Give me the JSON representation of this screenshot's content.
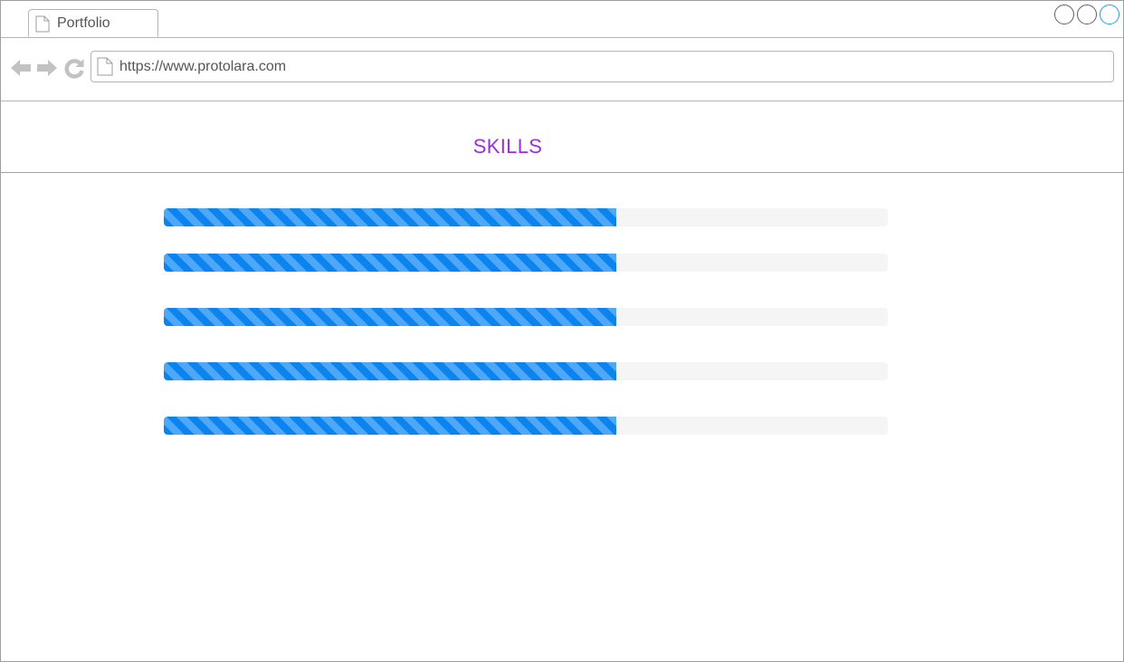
{
  "browser": {
    "tab_title": "Portfolio",
    "url": "https://www.protolara.com",
    "icons": {
      "back": "arrow-left-icon",
      "forward": "arrow-right-icon",
      "reload": "reload-icon",
      "page": "document-icon"
    },
    "window_controls": [
      "minimize",
      "maximize",
      "close"
    ]
  },
  "page": {
    "title": "SKILLS",
    "title_color": "#9b30d9"
  },
  "skills": {
    "bar_color": "#0b84f0",
    "track_color": "#f5f5f5",
    "items": [
      {
        "progress": 0.625
      },
      {
        "progress": 0.625
      },
      {
        "progress": 0.625
      },
      {
        "progress": 0.625
      },
      {
        "progress": 0.625
      }
    ]
  }
}
